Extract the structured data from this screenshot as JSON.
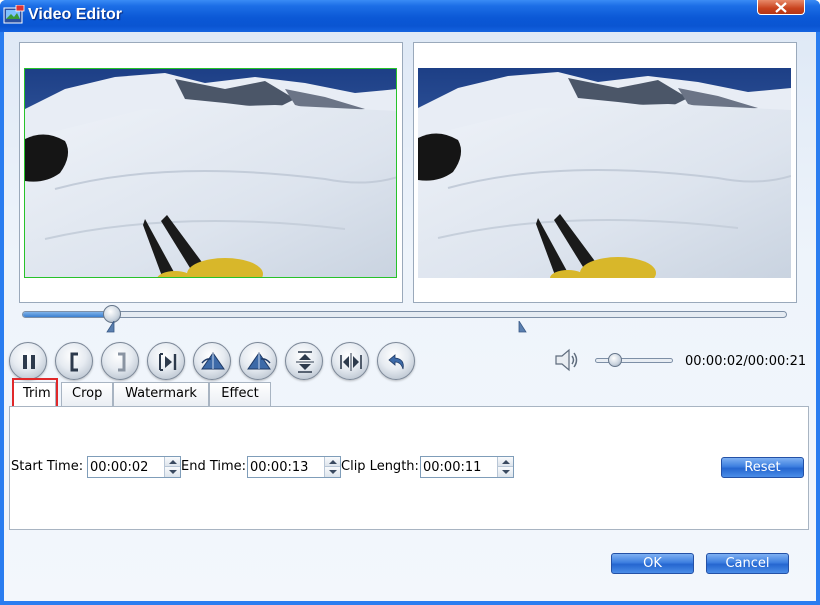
{
  "window": {
    "title": "Video Editor"
  },
  "playback": {
    "position_fraction": 0.117,
    "trim_start_fraction": 0.12,
    "trim_end_fraction": 0.65,
    "volume_fraction": 0.25,
    "time_readout": "00:00:02/00:00:21"
  },
  "controls": [
    {
      "name": "pause-button",
      "icon": "pause-icon"
    },
    {
      "name": "set-start-button",
      "icon": "left-bracket-icon"
    },
    {
      "name": "set-end-button",
      "icon": "right-bracket-icon"
    },
    {
      "name": "next-frame-button",
      "icon": "step-forward-icon"
    },
    {
      "name": "rotate-left-button",
      "icon": "rotate-left-icon"
    },
    {
      "name": "rotate-right-button",
      "icon": "rotate-right-icon"
    },
    {
      "name": "flip-vertical-button",
      "icon": "flip-vertical-icon"
    },
    {
      "name": "flip-horizontal-button",
      "icon": "flip-horizontal-icon"
    },
    {
      "name": "undo-button",
      "icon": "undo-icon"
    }
  ],
  "tabs": [
    {
      "label": "Trim",
      "active": true
    },
    {
      "label": "Crop",
      "active": false
    },
    {
      "label": "Watermark",
      "active": false
    },
    {
      "label": "Effect",
      "active": false
    }
  ],
  "trim": {
    "start_label": "Start Time:",
    "start_value": "00:00:02",
    "end_label": "End Time:",
    "end_value": "00:00:13",
    "length_label": "Clip Length:",
    "length_value": "00:00:11",
    "reset_label": "Reset"
  },
  "footer": {
    "ok_label": "OK",
    "cancel_label": "Cancel"
  }
}
